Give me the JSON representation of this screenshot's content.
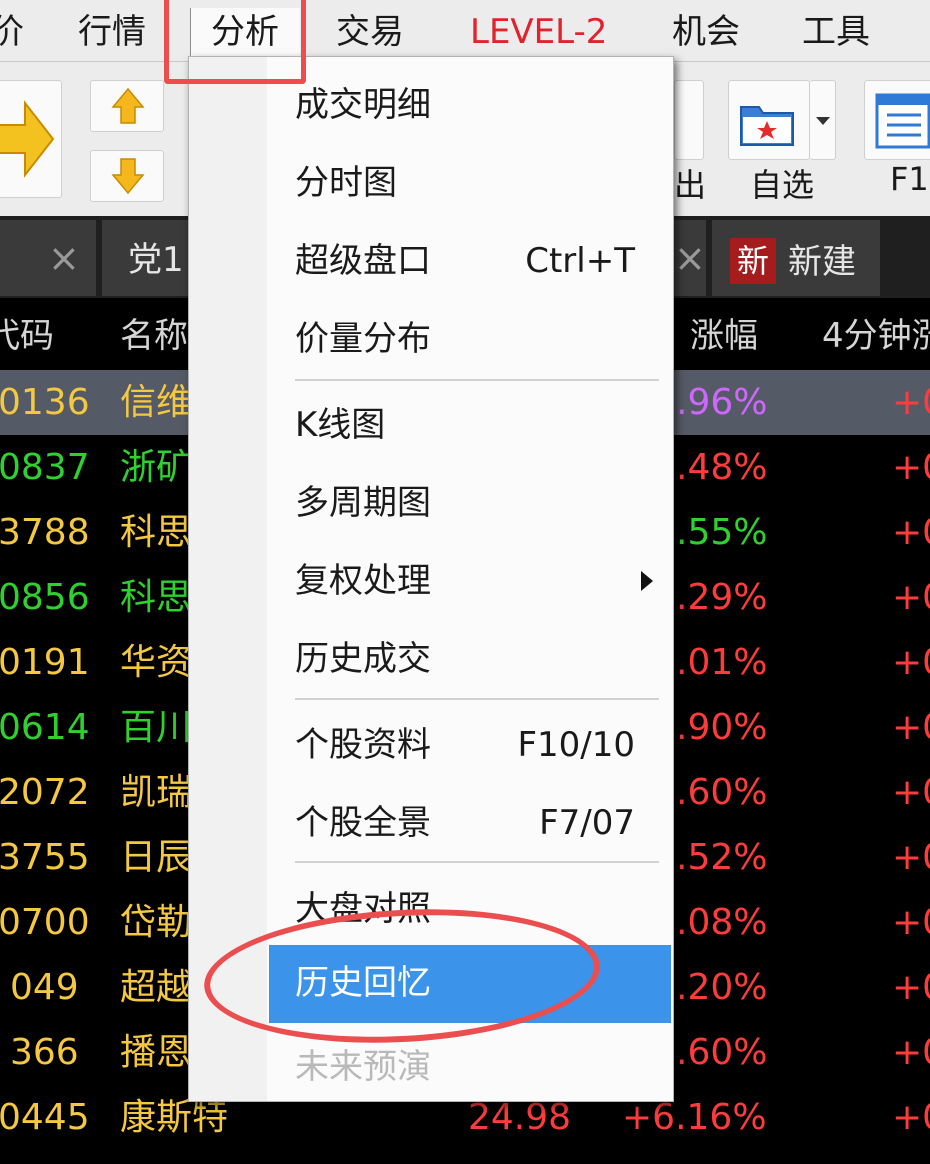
{
  "menubar": {
    "items": [
      {
        "label": "价"
      },
      {
        "label": "行情"
      },
      {
        "label": "分析"
      },
      {
        "label": "交易"
      },
      {
        "label": "LEVEL-2"
      },
      {
        "label": "机会"
      },
      {
        "label": "工具"
      }
    ]
  },
  "toolbar": {
    "partial_label": "出",
    "favorites_label": "自选",
    "f10_label": "F1",
    "up_arrow_icon": "up-arrow-icon",
    "down_arrow_icon": "down-arrow-icon",
    "folder_icon": "folder-star-icon"
  },
  "tabs": {
    "first_close": "×",
    "second_label": "党1",
    "second_close": "×",
    "new_badge": "新",
    "new_label": "新建"
  },
  "table": {
    "headers": {
      "code": "代码",
      "name": "名称",
      "pct": "涨幅",
      "min4": "4分钟涨"
    },
    "rows": [
      {
        "code": "0136",
        "name": "信维",
        "pct": ".96%",
        "min4": "+0"
      },
      {
        "code": "0837",
        "name": "浙矿",
        "pct": ".48%",
        "min4": "+0"
      },
      {
        "code": "3788",
        "name": "科思",
        "pct": ".55%",
        "min4": "+0"
      },
      {
        "code": "0856",
        "name": "科思",
        "pct": ".29%",
        "min4": "+0"
      },
      {
        "code": "0191",
        "name": "华资",
        "pct": ".01%",
        "min4": "+0"
      },
      {
        "code": "0614",
        "name": "百川",
        "pct": ".90%",
        "min4": "+0"
      },
      {
        "code": "2072",
        "name": "凯瑞",
        "pct": ".60%",
        "min4": "+0"
      },
      {
        "code": "3755",
        "name": "日辰",
        "pct": ".52%",
        "min4": "+0"
      },
      {
        "code": "0700",
        "name": "岱勒",
        "pct": ".08%",
        "min4": "+0"
      },
      {
        "code": "049",
        "name": "超越",
        "pct": ".20%",
        "min4": "+0"
      },
      {
        "code": "366",
        "name": "播恩",
        "pct": ".60%",
        "min4": "+0"
      },
      {
        "code": "0445",
        "name": "康斯特",
        "price": "24.98",
        "pct": "+6.16%",
        "min4": "+0"
      }
    ]
  },
  "dropdown": {
    "items": [
      {
        "label": "成交明细"
      },
      {
        "label": "分时图"
      },
      {
        "label": "超级盘口",
        "shortcut": "Ctrl+T"
      },
      {
        "label": "价量分布"
      },
      {
        "label": "K线图"
      },
      {
        "label": "多周期图"
      },
      {
        "label": "复权处理"
      },
      {
        "label": "历史成交"
      },
      {
        "label": "个股资料",
        "shortcut": "F10/10"
      },
      {
        "label": "个股全景",
        "shortcut": "F7/07"
      },
      {
        "label": "大盘对照"
      },
      {
        "label": "历史回忆"
      },
      {
        "label": "未来预演"
      }
    ]
  },
  "colors": {
    "highlight": "#3c93ea",
    "annotation": "#ea4e4e",
    "up": "#ff3b3b",
    "down": "#2ed12e",
    "code": "#f5c842"
  }
}
